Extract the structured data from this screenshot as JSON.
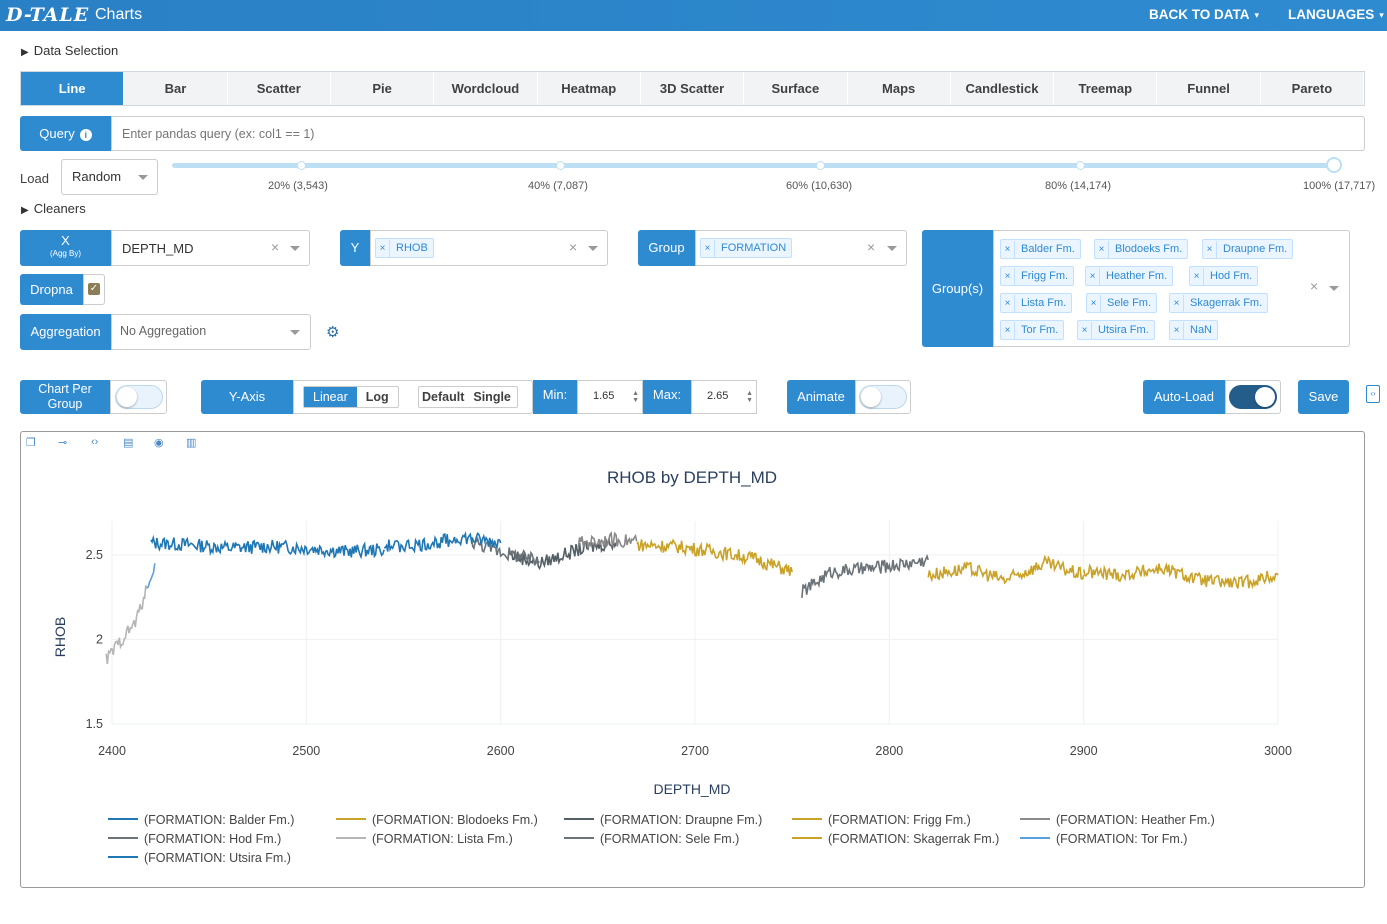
{
  "app": {
    "logo": "D-TALE",
    "title": "Charts",
    "back_label": "BACK TO DATA",
    "languages_label": "LANGUAGES"
  },
  "sections": {
    "data_selection": "Data Selection",
    "cleaners": "Cleaners"
  },
  "chart_tabs": [
    "Line",
    "Bar",
    "Scatter",
    "Pie",
    "Wordcloud",
    "Heatmap",
    "3D Scatter",
    "Surface",
    "Maps",
    "Candlestick",
    "Treemap",
    "Funnel",
    "Pareto"
  ],
  "query": {
    "label": "Query",
    "placeholder": "Enter pandas query (ex: col1 == 1)"
  },
  "load": {
    "label": "Load",
    "value": "Random",
    "marks": [
      "20% (3,543)",
      "40% (7,087)",
      "60% (10,630)",
      "80% (14,174)",
      "100% (17,717)"
    ],
    "selected_percent": 100
  },
  "x": {
    "label": "X",
    "sublabel": "(Agg By)",
    "value": "DEPTH_MD"
  },
  "y": {
    "label": "Y",
    "chips": [
      "RHOB"
    ]
  },
  "group": {
    "label": "Group",
    "chips": [
      "FORMATION"
    ]
  },
  "groups": {
    "label": "Group(s)",
    "chips": [
      "Balder Fm.",
      "Blodoeks Fm.",
      "Draupne Fm.",
      "Frigg Fm.",
      "Heather Fm.",
      "Hod Fm.",
      "Lista Fm.",
      "Sele Fm.",
      "Skagerrak Fm.",
      "Tor Fm.",
      "Utsira Fm.",
      "NaN"
    ]
  },
  "dropna": {
    "label": "Dropna",
    "checked": true
  },
  "aggregation": {
    "label": "Aggregation",
    "value": "No Aggregation"
  },
  "controls": {
    "chart_per_group_label": "Chart Per Group",
    "yaxis_label": "Y-Axis",
    "scale_options": [
      "Linear",
      "Log"
    ],
    "yaxis_type_options": [
      "Default",
      "Single"
    ],
    "min_label": "Min:",
    "min_value": "1.65",
    "max_label": "Max:",
    "max_value": "2.65",
    "animate_label": "Animate",
    "autoload_label": "Auto-Load",
    "autoload_on": true,
    "save_label": "Save"
  },
  "colors": {
    "accent": "#2f8bd0",
    "blue_series": "#1f77b4",
    "gold_series": "#c9a227",
    "slate_series": "#5f6b74",
    "gray_series": "#b0b0b0"
  },
  "chart_data": {
    "type": "line",
    "title": "RHOB by DEPTH_MD",
    "xlabel": "DEPTH_MD",
    "ylabel": "RHOB",
    "xlim": [
      2400,
      3000
    ],
    "ylim": [
      1.5,
      2.7
    ],
    "x_ticks": [
      "2400",
      "2500",
      "2600",
      "2700",
      "2800",
      "2900",
      "3000"
    ],
    "y_ticks": [
      "1.5",
      "2",
      "2.5"
    ],
    "legend_placement": "bottom",
    "series": [
      {
        "name": "(FORMATION: Balder Fm.)",
        "color": "#1f77b4",
        "x": [
          2420,
          2440,
          2460,
          2480,
          2500,
          2520,
          2540
        ],
        "y": [
          2.57,
          2.56,
          2.54,
          2.55,
          2.54,
          2.52,
          2.53
        ]
      },
      {
        "name": "(FORMATION: Blodoeks Fm.)",
        "color": "#c9a227",
        "x": [
          2670,
          2690,
          2710,
          2730,
          2750
        ],
        "y": [
          2.56,
          2.55,
          2.52,
          2.48,
          2.4
        ]
      },
      {
        "name": "(FORMATION: Draupne Fm.)",
        "color": "#555f66",
        "x": [
          2605,
          2620,
          2640,
          2660
        ],
        "y": [
          2.5,
          2.45,
          2.53,
          2.58
        ]
      },
      {
        "name": "(FORMATION: Frigg Fm.)",
        "color": "#c9a227",
        "x": [
          2820,
          2840,
          2860,
          2880,
          2900
        ],
        "y": [
          2.38,
          2.42,
          2.35,
          2.45,
          2.38
        ]
      },
      {
        "name": "(FORMATION: Heather Fm.)",
        "color": "#8a8a8a",
        "x": [
          2640,
          2655,
          2670
        ],
        "y": [
          2.57,
          2.59,
          2.58
        ]
      },
      {
        "name": "(FORMATION: Hod Fm.)",
        "color": "#6b7378",
        "x": [
          2755,
          2770,
          2790,
          2810,
          2820
        ],
        "y": [
          2.28,
          2.4,
          2.42,
          2.45,
          2.47
        ]
      },
      {
        "name": "(FORMATION: Lista Fm.)",
        "color": "#b5b5b5",
        "x": [
          2397,
          2405,
          2412,
          2418
        ],
        "y": [
          1.88,
          2.0,
          2.1,
          2.3
        ]
      },
      {
        "name": "(FORMATION: Sele Fm.)",
        "color": "#6a7378",
        "x": [
          2585,
          2600,
          2620
        ],
        "y": [
          2.58,
          2.52,
          2.46
        ]
      },
      {
        "name": "(FORMATION: Skagerrak Fm.)",
        "color": "#c9a227",
        "x": [
          2900,
          2920,
          2940,
          2960,
          2980,
          3000
        ],
        "y": [
          2.4,
          2.38,
          2.42,
          2.35,
          2.33,
          2.38
        ]
      },
      {
        "name": "(FORMATION: Tor Fm.)",
        "color": "#5aa0dc",
        "x": [
          2418,
          2422
        ],
        "y": [
          2.3,
          2.45
        ]
      },
      {
        "name": "(FORMATION: Utsira Fm.)",
        "color": "#1f77b4",
        "x": [
          2540,
          2560,
          2580,
          2600
        ],
        "y": [
          2.55,
          2.56,
          2.6,
          2.57
        ]
      }
    ]
  }
}
